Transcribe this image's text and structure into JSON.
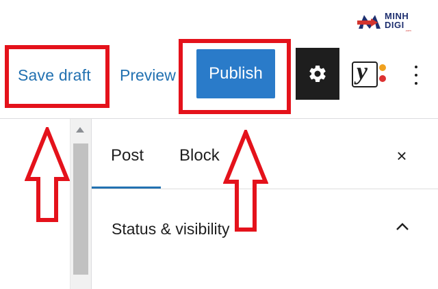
{
  "logo": {
    "line1": "MINH",
    "line2": "DIGI",
    "sub": ".com"
  },
  "toolbar": {
    "save_draft_label": "Save draft",
    "preview_label": "Preview",
    "publish_label": "Publish",
    "settings_icon": "gear-icon",
    "plugin_icon": "yoast-icon",
    "more_icon": "more-vertical-icon"
  },
  "sidebar": {
    "tabs": [
      {
        "label": "Post",
        "active": true
      },
      {
        "label": "Block",
        "active": false
      }
    ],
    "close_label": "×",
    "panels": [
      {
        "title": "Status & visibility",
        "expanded": true
      }
    ]
  },
  "colors": {
    "accent": "#2271b1",
    "publish_bg": "#2a7bc9",
    "annotation_red": "#e4121b",
    "dark": "#1e1e1e",
    "logo_navy": "#1e2f6f",
    "logo_red": "#d3352f"
  }
}
